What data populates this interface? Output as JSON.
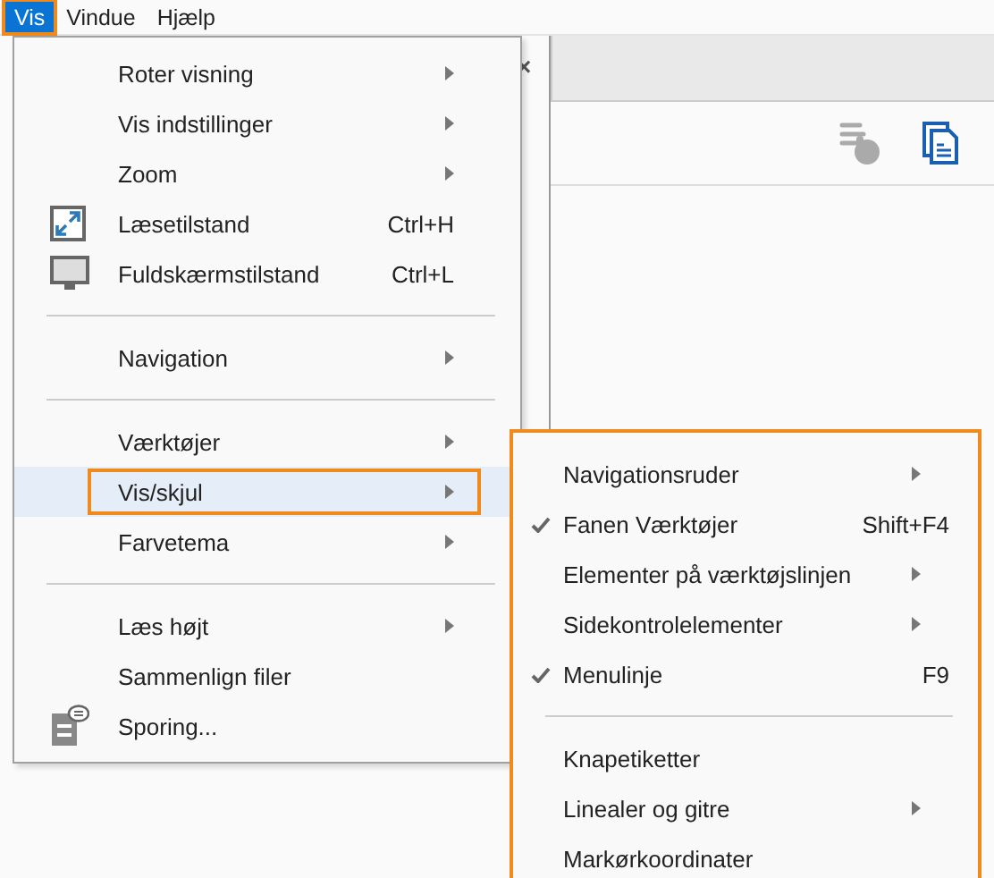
{
  "menubar": [
    {
      "label": "Vis",
      "selected": true
    },
    {
      "label": "Vindue",
      "selected": false
    },
    {
      "label": "Hjælp",
      "selected": false
    }
  ],
  "menu": {
    "items": [
      {
        "kind": "item",
        "label": "Roter visning",
        "submenu": true,
        "selected": false
      },
      {
        "kind": "item",
        "label": "Vis indstillinger",
        "submenu": true,
        "selected": false
      },
      {
        "kind": "item",
        "label": "Zoom",
        "submenu": true,
        "selected": false
      },
      {
        "kind": "expand",
        "label": "Læsetilstand",
        "shortcut": "Ctrl+H",
        "selected": false
      },
      {
        "kind": "monitor",
        "label": "Fuldskærmstilstand",
        "shortcut": "Ctrl+L",
        "selected": false
      },
      {
        "kind": "separator"
      },
      {
        "kind": "item",
        "label": "Navigation",
        "submenu": true,
        "selected": false
      },
      {
        "kind": "separator"
      },
      {
        "kind": "item",
        "label": "Værktøjer",
        "submenu": true,
        "selected": false
      },
      {
        "kind": "item",
        "label": "Vis/skjul",
        "submenu": true,
        "selected": true
      },
      {
        "kind": "item",
        "label": "Farvetema",
        "submenu": true,
        "selected": false
      },
      {
        "kind": "separator"
      },
      {
        "kind": "item",
        "label": "Læs højt",
        "submenu": true,
        "selected": false
      },
      {
        "kind": "item",
        "label": "Sammenlign filer",
        "selected": false
      },
      {
        "kind": "tracker",
        "label": "Sporing...",
        "selected": false
      }
    ]
  },
  "tab_close": "×",
  "submenu": {
    "items": [
      {
        "kind": "item",
        "label": "Navigationsruder",
        "submenu": true,
        "checked": false
      },
      {
        "kind": "item",
        "label": "Fanen Værktøjer",
        "shortcut": "Shift+F4",
        "checked": true
      },
      {
        "kind": "item",
        "label": "Elementer på værktøjslinjen",
        "submenu": true,
        "checked": false
      },
      {
        "kind": "item",
        "label": "Sidekontrolelementer",
        "submenu": true,
        "checked": false
      },
      {
        "kind": "item",
        "label": "Menulinje",
        "shortcut": "F9",
        "checked": true
      },
      {
        "kind": "separator"
      },
      {
        "kind": "item",
        "label": "Knapetiketter",
        "checked": false
      },
      {
        "kind": "item",
        "label": "Linealer og gitre",
        "submenu": true,
        "checked": false
      },
      {
        "kind": "item",
        "label": "Markørkoordinater",
        "checked": false
      }
    ]
  }
}
